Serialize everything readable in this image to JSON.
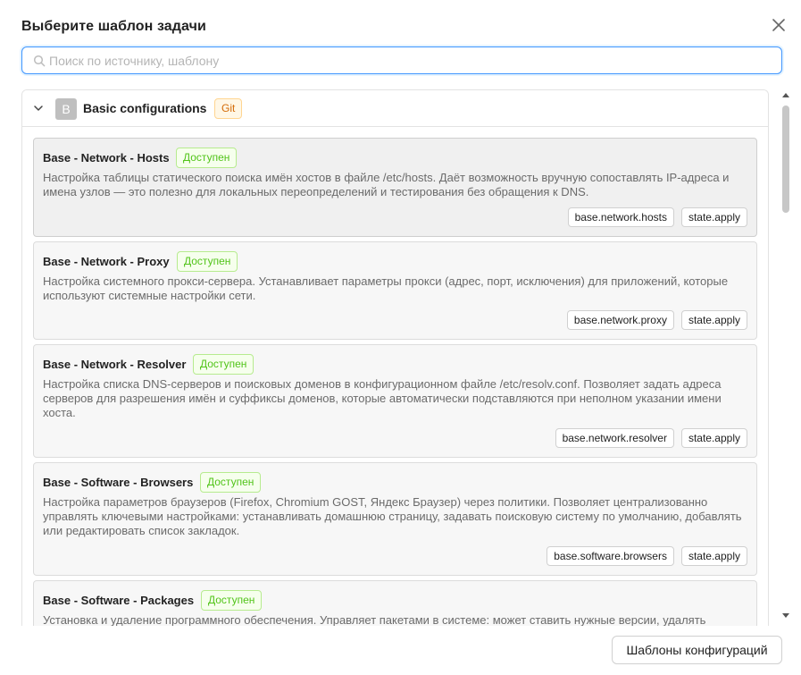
{
  "dialog": {
    "title": "Выберите шаблон задачи",
    "close_icon": "close-icon"
  },
  "search": {
    "placeholder": "Поиск по источнику, шаблону",
    "value": "",
    "icon": "search-icon"
  },
  "group": {
    "expanded": true,
    "avatar_letter": "B",
    "name": "Basic configurations",
    "badge": "Git",
    "badge_color": "#d46b08"
  },
  "templates": [
    {
      "title": "Base - Network - Hosts",
      "status": "Доступен",
      "description": "Настройка таблицы статического поиска имён хостов в файле /etc/hosts. Даёт возможность вручную сопоставлять IP-адреса и имена узлов — это полезно для локальных переопределений и тестирования без обращения к DNS.",
      "tags": [
        "base.network.hosts",
        "state.apply"
      ]
    },
    {
      "title": "Base - Network - Proxy",
      "status": "Доступен",
      "description": "Настройка системного прокси-сервера. Устанавливает параметры прокси (адрес, порт, исключения) для приложений, которые используют системные настройки сети.",
      "tags": [
        "base.network.proxy",
        "state.apply"
      ]
    },
    {
      "title": "Base - Network - Resolver",
      "status": "Доступен",
      "description": "Настройка списка DNS-серверов и поисковых доменов в конфигурационном файле /etc/resolv.conf. Позволяет задать адреса серверов для разрешения имён и суффиксы доменов, которые автоматически подставляются при неполном указании имени хоста.",
      "tags": [
        "base.network.resolver",
        "state.apply"
      ]
    },
    {
      "title": "Base - Software - Browsers",
      "status": "Доступен",
      "description": "Настройка параметров браузеров (Firefox, Chromium GOST, Яндекс Браузер) через политики. Позволяет централизованно управлять ключевыми настройками: устанавливать домашнюю страницу, задавать поисковую систему по умолчанию, добавлять или редактировать список закладок.",
      "tags": [
        "base.software.browsers",
        "state.apply"
      ]
    },
    {
      "title": "Base - Software - Packages",
      "status": "Доступен",
      "description": "Установка и удаление программного обеспечения. Управляет пакетами в системе: может ставить нужные версии, удалять",
      "tags": []
    }
  ],
  "footer": {
    "button_label": "Шаблоны конфигураций"
  },
  "colors": {
    "accent": "#4096ff",
    "status_green": "#52c41a",
    "git_orange": "#d46b08"
  }
}
